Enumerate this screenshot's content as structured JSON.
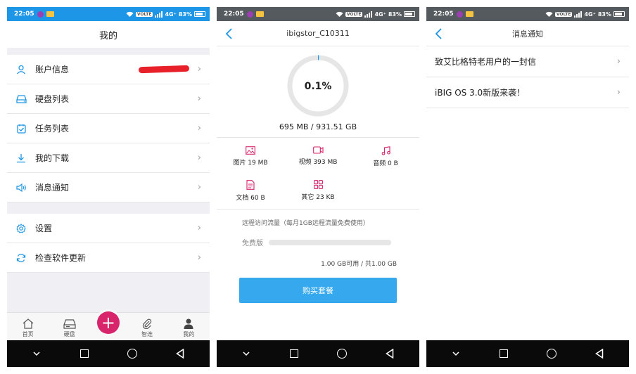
{
  "status": {
    "time": "22:05",
    "network": "4G⁺",
    "volte": "VOLTE",
    "battery": "83%"
  },
  "panel1": {
    "title": "我的",
    "items": [
      {
        "label": "账户信息",
        "icon": "user-icon"
      },
      {
        "label": "硬盘列表",
        "icon": "hard-drive-icon"
      },
      {
        "label": "任务列表",
        "icon": "task-list-icon"
      },
      {
        "label": "我的下载",
        "icon": "download-icon"
      },
      {
        "label": "消息通知",
        "icon": "speaker-icon"
      }
    ],
    "settings_items": [
      {
        "label": "设置",
        "icon": "gear-icon"
      },
      {
        "label": "检查软件更新",
        "icon": "refresh-icon"
      }
    ],
    "tabs": [
      {
        "label": "首页",
        "icon": "home-icon"
      },
      {
        "label": "硬盘",
        "icon": "hard-drive-icon"
      },
      {
        "label": "智连",
        "icon": "paperclip-icon"
      },
      {
        "label": "我的",
        "icon": "person-icon"
      }
    ],
    "fab_label": "+",
    "accent": "#1e96e8",
    "fab_color": "#d7246a"
  },
  "panel2": {
    "title": "ibigstor_C10311",
    "usage_percent_label": "0.1%",
    "usage_fraction": 0.001,
    "storage": "695 MB / 931.51 GB",
    "categories": [
      {
        "label": "图片 19 MB",
        "icon": "image-icon"
      },
      {
        "label": "视频 393 MB",
        "icon": "video-icon"
      },
      {
        "label": "音频 0 B",
        "icon": "music-icon"
      },
      {
        "label": "文档 60 B",
        "icon": "document-icon"
      },
      {
        "label": "其它 23 KB",
        "icon": "grid-icon"
      }
    ],
    "traffic_note": "远程访问流量（每月1GB远程流量免费使用）",
    "free_label": "免费版",
    "free_used_fraction": 0,
    "free_usage_text": "1.00 GB可用 / 共1.00 GB",
    "buy_label": "购买套餐",
    "icon_color": "#d7246a",
    "button_color": "#35a8ee"
  },
  "panel3": {
    "title": "消息通知",
    "messages": [
      {
        "label": "致艾比格特老用户的一封信"
      },
      {
        "label": "iBIG OS 3.0新版来袭！"
      }
    ]
  }
}
